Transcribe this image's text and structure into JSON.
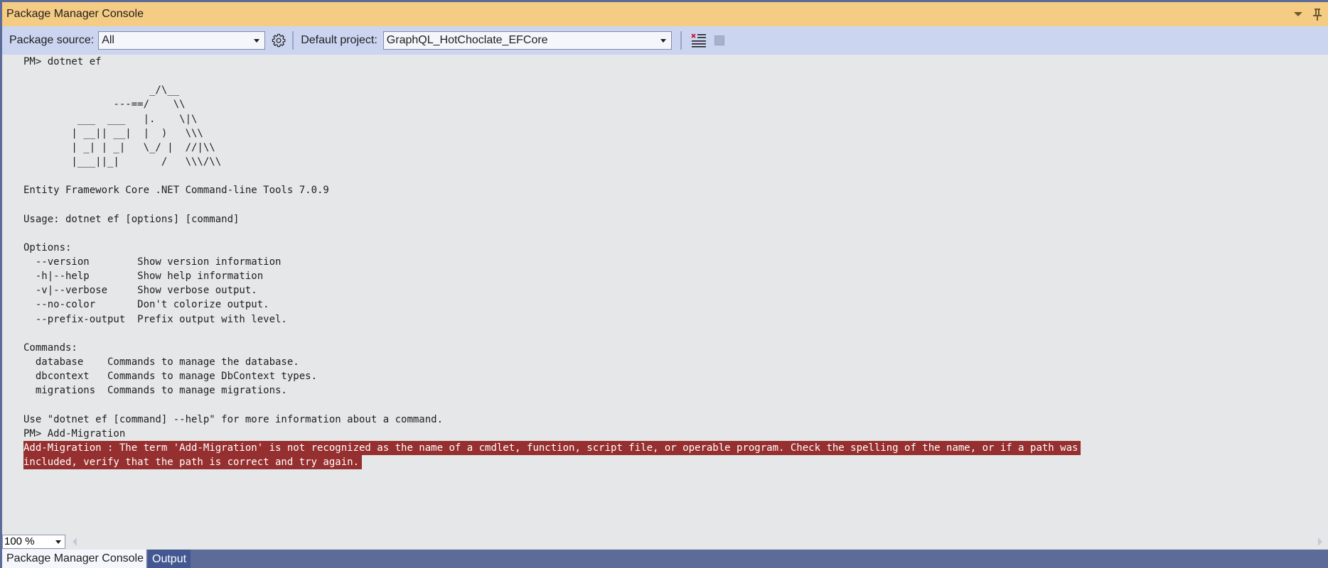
{
  "window": {
    "title": "Package Manager Console"
  },
  "toolbar": {
    "package_source_label": "Package source:",
    "package_source_value": "All",
    "default_project_label": "Default project:",
    "default_project_value": "GraphQL_HotChoclate_EFCore",
    "icons": {
      "settings": "gear-icon",
      "clear": "clear-console-icon",
      "stop": "stop-icon"
    }
  },
  "console": {
    "lines": [
      "PM> dotnet ef",
      "",
      "                     _/\\__",
      "               ---==/    \\\\",
      "         ___  ___   |.    \\|\\",
      "        | __|| __|  |  )   \\\\\\",
      "        | _| | _|   \\_/ |  //|\\\\",
      "        |___||_|       /   \\\\\\/\\\\",
      "",
      "Entity Framework Core .NET Command-line Tools 7.0.9",
      "",
      "Usage: dotnet ef [options] [command]",
      "",
      "Options:",
      "  --version        Show version information",
      "  -h|--help        Show help information",
      "  -v|--verbose     Show verbose output.",
      "  --no-color       Don't colorize output.",
      "  --prefix-output  Prefix output with level.",
      "",
      "Commands:",
      "  database    Commands to manage the database.",
      "  dbcontext   Commands to manage DbContext types.",
      "  migrations  Commands to manage migrations.",
      "",
      "Use \"dotnet ef [command] --help\" for more information about a command.",
      "PM> Add-Migration"
    ],
    "error_lines": [
      "Add-Migration : The term 'Add-Migration' is not recognized as the name of a cmdlet, function, script file, or operable program. Check the spelling of the name, or if a path was",
      "included, verify that the path is correct and try again."
    ],
    "colors": {
      "background": "#e6e7e8",
      "error_background": "#962f2f",
      "error_text": "#ffffff"
    }
  },
  "statusbar": {
    "zoom_level": "100 %"
  },
  "tabs": [
    {
      "label": "Package Manager Console",
      "active": true
    },
    {
      "label": "Output",
      "active": false
    }
  ],
  "colors": {
    "title_bar": "#f5cc84",
    "toolbar": "#ccd5f0",
    "tab_strip": "#5d6b99"
  }
}
